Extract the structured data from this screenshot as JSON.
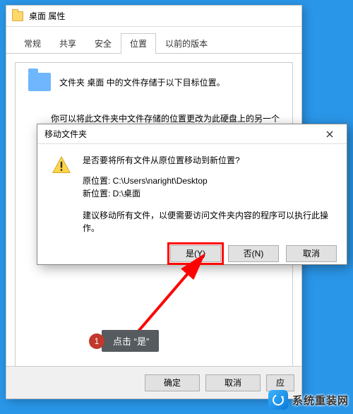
{
  "propWindow": {
    "title": "桌面 属性",
    "tabs": [
      "常规",
      "共享",
      "安全",
      "位置",
      "以前的版本"
    ],
    "activeTab": 3,
    "line1": "文件夹 桌面 中的文件存储于以下目标位置。",
    "line2": "你可以将此文件夹中文件存储的位置更改为此硬盘上的另一个位",
    "buttons": {
      "ok": "确定",
      "cancel": "取消",
      "apply": "应"
    }
  },
  "dialog": {
    "title": "移动文件夹",
    "question": "是否要将所有文件从原位置移动到新位置?",
    "oldLabel": "原位置: ",
    "oldPath": "C:\\Users\\naright\\Desktop",
    "newLabel": "新位置: ",
    "newPath": "D:\\桌面",
    "advice": "建议移动所有文件，以便需要访问文件夹内容的程序可以执行此操作。",
    "yes": "是(Y)",
    "no": "否(N)",
    "cancel": "取消"
  },
  "annotation": {
    "num": "1",
    "text": "点击 “是”"
  },
  "watermark": "系统重装网"
}
